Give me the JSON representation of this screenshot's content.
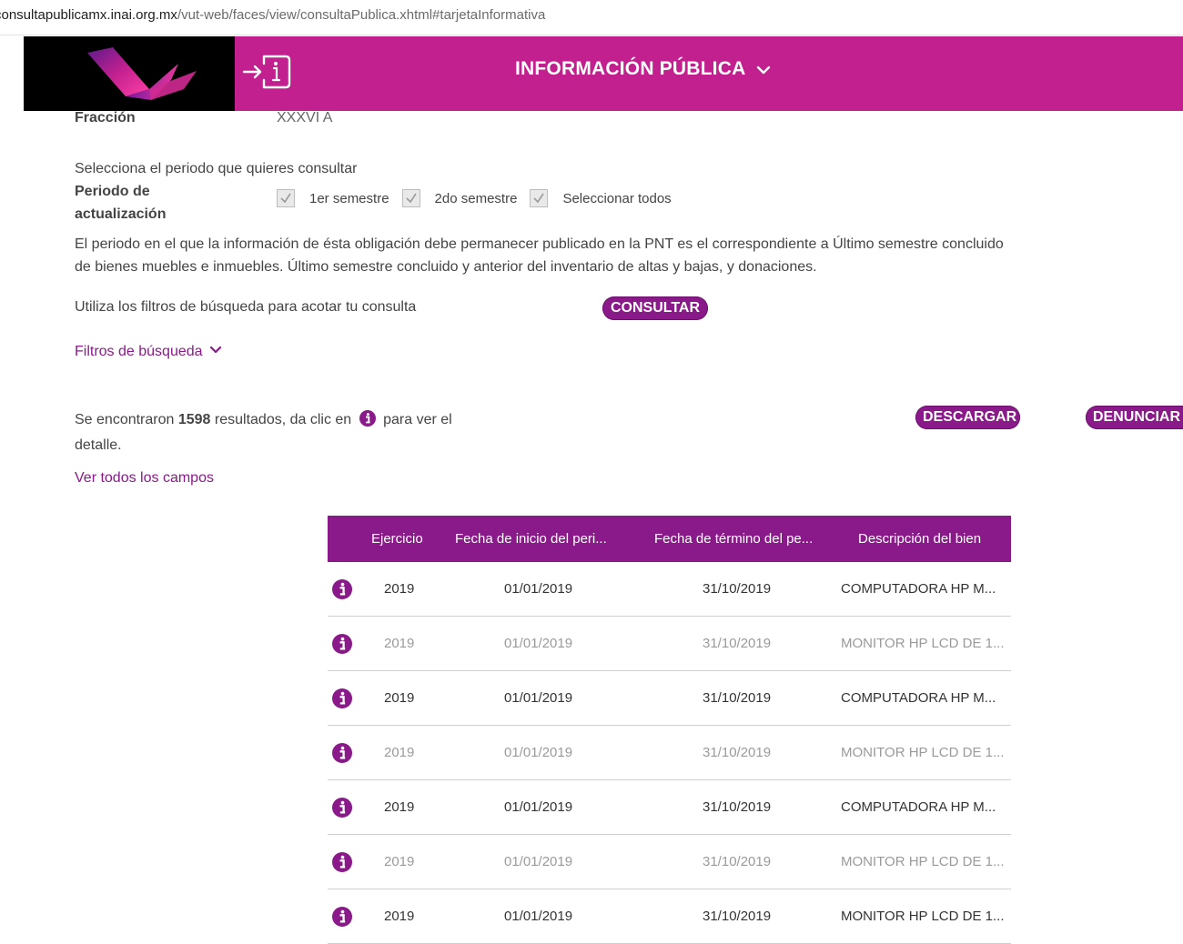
{
  "browser": {
    "url_host": "consultapublicamx.inai.org.mx",
    "url_path": "/vut-web/faces/view/consultaPublica.xhtml#tarjetaInformativa"
  },
  "header": {
    "title": "INFORMACIÓN PÚBLICA",
    "brand_color": "#c2208f"
  },
  "fraccion": {
    "label": "Fracción",
    "value": "XXXVI A"
  },
  "periodo": {
    "prompt": "Selecciona el periodo que quieres consultar",
    "label_line1": "Periodo de",
    "label_line2": "actualización",
    "options": [
      {
        "label": "1er semestre",
        "checked": true
      },
      {
        "label": "2do semestre",
        "checked": true
      },
      {
        "label": "Seleccionar todos",
        "checked": true
      }
    ]
  },
  "description": {
    "line1": "El periodo en el que la información de ésta obligación debe permanecer publicado en la PNT es el correspondiente a Último semestre concluido",
    "line2": "de bienes muebles e inmuebles. Último semestre concluido y anterior del inventario de altas y bajas, y donaciones."
  },
  "search": {
    "hint": "Utiliza los filtros de búsqueda para acotar tu consulta",
    "consult_button": "CONSULTAR",
    "filters_link": "Filtros de búsqueda"
  },
  "results": {
    "prefix": "Se encontraron ",
    "count": "1598",
    "middle": " resultados, da clic en ",
    "suffix": " para ver el",
    "suffix_line2": "detalle.",
    "download_button": "DESCARGAR",
    "report_button": "DENUNCIAR",
    "view_all_link": "Ver todos los campos"
  },
  "table": {
    "accent_color": "#8a1a8a",
    "columns": [
      "Ejercicio",
      "Fecha de inicio del peri...",
      "Fecha de término del pe...",
      "Descripción del bien"
    ],
    "rows": [
      {
        "ejercicio": "2019",
        "inicio": "01/01/2019",
        "termino": "31/10/2019",
        "descripcion": "COMPUTADORA HP M..."
      },
      {
        "ejercicio": "2019",
        "inicio": "01/01/2019",
        "termino": "31/10/2019",
        "descripcion": "MONITOR HP LCD DE 1..."
      },
      {
        "ejercicio": "2019",
        "inicio": "01/01/2019",
        "termino": "31/10/2019",
        "descripcion": "COMPUTADORA HP M..."
      },
      {
        "ejercicio": "2019",
        "inicio": "01/01/2019",
        "termino": "31/10/2019",
        "descripcion": "MONITOR HP LCD DE 1..."
      },
      {
        "ejercicio": "2019",
        "inicio": "01/01/2019",
        "termino": "31/10/2019",
        "descripcion": "COMPUTADORA HP M..."
      },
      {
        "ejercicio": "2019",
        "inicio": "01/01/2019",
        "termino": "31/10/2019",
        "descripcion": "MONITOR HP LCD DE 1..."
      },
      {
        "ejercicio": "2019",
        "inicio": "01/01/2019",
        "termino": "31/10/2019",
        "descripcion": "MONITOR HP LCD DE 1..."
      }
    ]
  }
}
